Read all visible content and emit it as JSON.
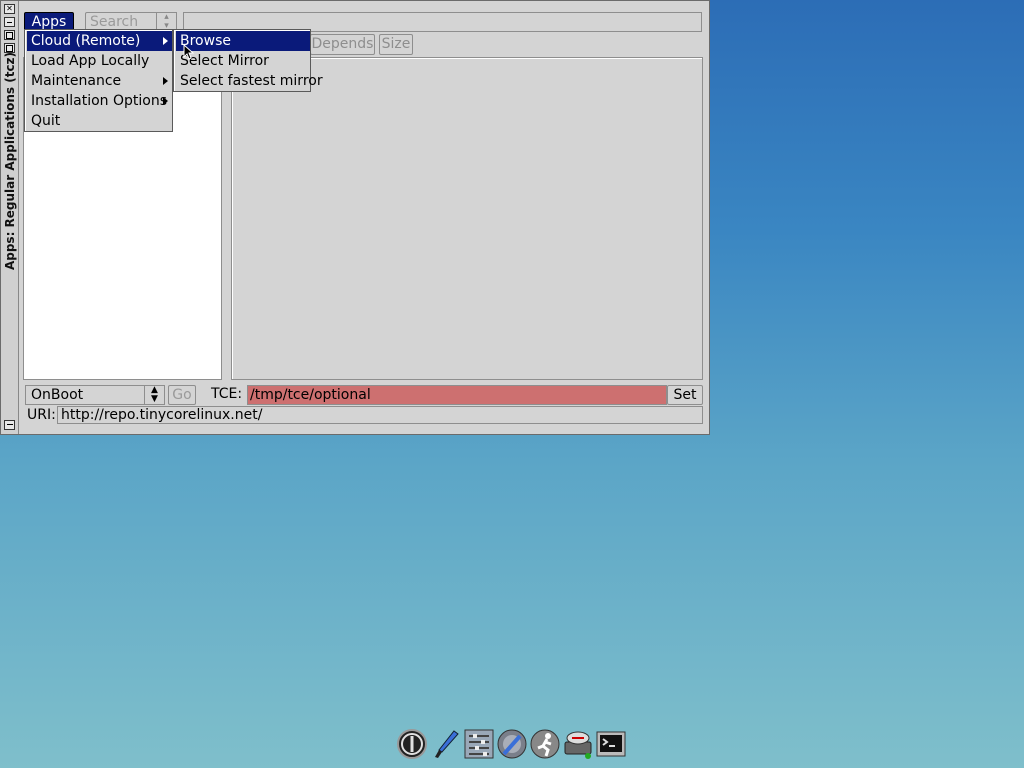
{
  "window": {
    "title": "Apps: Regular Applications (tcz)",
    "close_glyph": "✕",
    "toolbar": {
      "apps_label": "Apps",
      "search_label": "Search",
      "search_value": ""
    },
    "tabs": {
      "depends": "Depends",
      "size": "Size"
    },
    "footer": {
      "onboot_value": "OnBoot",
      "go_label": "Go",
      "tce_label": "TCE:",
      "tce_value": "/tmp/tce/optional",
      "set_label": "Set",
      "uri_label": "URI:",
      "uri_value": "http://repo.tinycorelinux.net/"
    }
  },
  "menu_main": {
    "items": [
      {
        "label": "Cloud (Remote)",
        "submenu": true,
        "selected": true
      },
      {
        "label": "Load App Locally",
        "submenu": false
      },
      {
        "label": "Maintenance",
        "submenu": true
      },
      {
        "label": "Installation Options",
        "submenu": true
      },
      {
        "label": "Quit",
        "submenu": false
      }
    ]
  },
  "menu_cloud": {
    "items": [
      {
        "label": "Browse",
        "selected": true
      },
      {
        "label": "Select Mirror"
      },
      {
        "label": "Select fastest mirror"
      }
    ]
  },
  "dock": {
    "icons": [
      "power-icon",
      "paintbrush-icon",
      "control-panel-icon",
      "mount-tool-icon",
      "runner-icon",
      "apps-installer-icon",
      "terminal-icon"
    ]
  },
  "colors": {
    "selection": "#0a1a7a",
    "tce_field": "#cd7070",
    "window_bg": "#d4d4d4"
  }
}
